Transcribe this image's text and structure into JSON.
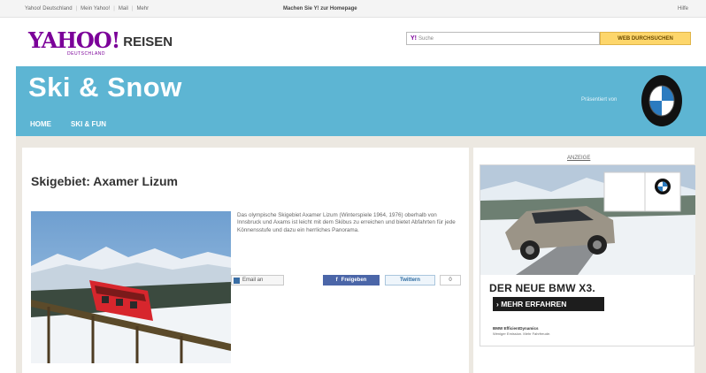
{
  "topbar": {
    "links": [
      "Yahoo! Deutschland",
      "Mein Yahoo!",
      "Mail",
      "Mehr"
    ],
    "center_text": "Machen Sie Y! zur Homepage",
    "help": "Hilfe"
  },
  "header": {
    "logo_text": "YAHOO!",
    "logo_sub": "DEUTSCHLAND",
    "section": "REISEN",
    "search_placeholder": "Suche",
    "search_button": "WEB DURCHSUCHEN"
  },
  "banner": {
    "title": "Ski & Snow",
    "presented_by": "Präsentiert von",
    "nav": [
      "HOME",
      "SKI & FUN"
    ]
  },
  "article": {
    "title": "Skigebiet: Axamer Lizum",
    "description": "Das olympische Skigebiet Axamer Lizum (Winterspiele 1964, 1976) oberhalb von Innsbruck und Axams ist leicht mit dem Skibus zu erreichen und bietet Abfahrten für jede Könnensstufe und dazu ein herrliches Panorama.",
    "share": {
      "email": "Email an",
      "facebook": "Freigeben",
      "twitter": "Twittern",
      "count": "0"
    }
  },
  "ad": {
    "label": "ANZEIGE",
    "headline": "DER NEUE BMW X3.",
    "cta": "› MEHR ERFAHREN",
    "small_line1": "BMW EfficientDynamics",
    "small_line2": "Weniger Emission. Mehr Fahrfreude."
  },
  "colors": {
    "banner_blue": "#5db5d3",
    "yahoo_purple": "#7b0099",
    "search_button": "#fdd66b",
    "facebook_blue": "#4b66a8",
    "content_bg": "#ece8e1"
  }
}
